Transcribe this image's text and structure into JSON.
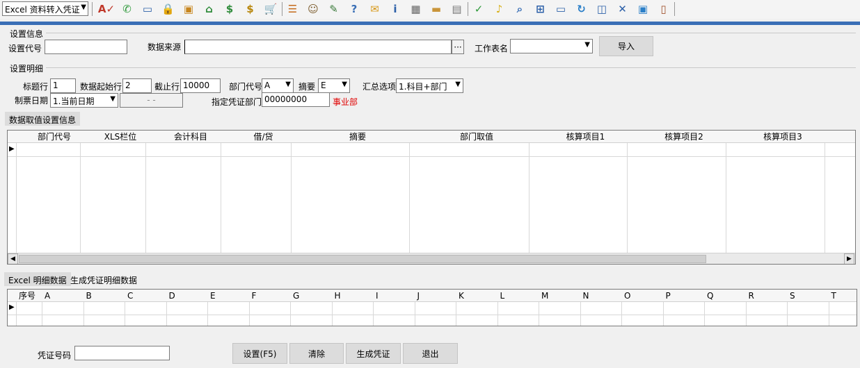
{
  "toolbar": {
    "mode_select": "Excel 资料转入凭证",
    "icons": [
      "spell-check-icon",
      "phone-icon",
      "computer-icon",
      "lock-icon",
      "briefcase-icon",
      "home-icon",
      "dollar-icon",
      "money-bag-icon",
      "cart-icon",
      "list-icon",
      "users-icon",
      "edit-icon",
      "help-icon",
      "mail-icon",
      "info-icon",
      "calculator-icon",
      "folder-icon",
      "document-icon",
      "check-icon",
      "bell-icon",
      "search-icon",
      "org-chart-icon",
      "monitor-icon",
      "refresh-icon",
      "window-icon",
      "close-icon",
      "minimize-icon",
      "exit-door-icon"
    ]
  },
  "settings_info": {
    "title": "设置信息",
    "code_label": "设置代号",
    "code_value": "",
    "source_label": "数据来源",
    "source_value": "",
    "browse_label": "···",
    "sheet_label": "工作表名",
    "sheet_value": "",
    "import_button": "导入"
  },
  "settings_detail": {
    "title": "设置明细",
    "header_row_label": "标题行",
    "header_row_value": "1",
    "start_row_label": "数据起始行",
    "start_row_value": "2",
    "end_row_label": "截止行",
    "end_row_value": "10000",
    "dept_code_label": "部门代号",
    "dept_code_value": "A",
    "summary_label": "摘要",
    "summary_value": "E",
    "aggregate_label": "汇总选项",
    "aggregate_value": "1.科目+部门",
    "date_label": "制票日期",
    "date_value": "1.当前日期",
    "date_extra": "- -",
    "voucher_dept_label": "指定凭证部门",
    "voucher_dept_value": "00000000",
    "voucher_dept_name": "事业部"
  },
  "fetch_tab": "数据取值设置信息",
  "fetch_grid": {
    "columns": [
      "部门代号",
      "XLS栏位",
      "会计科目",
      "借/贷",
      "摘要",
      "部门取值",
      "核算项目1",
      "核算项目2",
      "核算项目3"
    ]
  },
  "bottom_tabs": [
    "Excel 明细数据",
    "生成凭证明细数据"
  ],
  "excel_grid": {
    "columns": [
      "序号",
      "A",
      "B",
      "C",
      "D",
      "E",
      "F",
      "G",
      "H",
      "I",
      "J",
      "K",
      "L",
      "M",
      "N",
      "O",
      "P",
      "Q",
      "R",
      "S",
      "T"
    ]
  },
  "footer": {
    "voucher_no_label": "凭证号码",
    "voucher_no_value": "",
    "buttons": [
      "设置(F5)",
      "清除",
      "生成凭证",
      "退出"
    ]
  },
  "colors": {
    "accent_band": "#3a6fb6",
    "dept_name": "#e00000"
  }
}
